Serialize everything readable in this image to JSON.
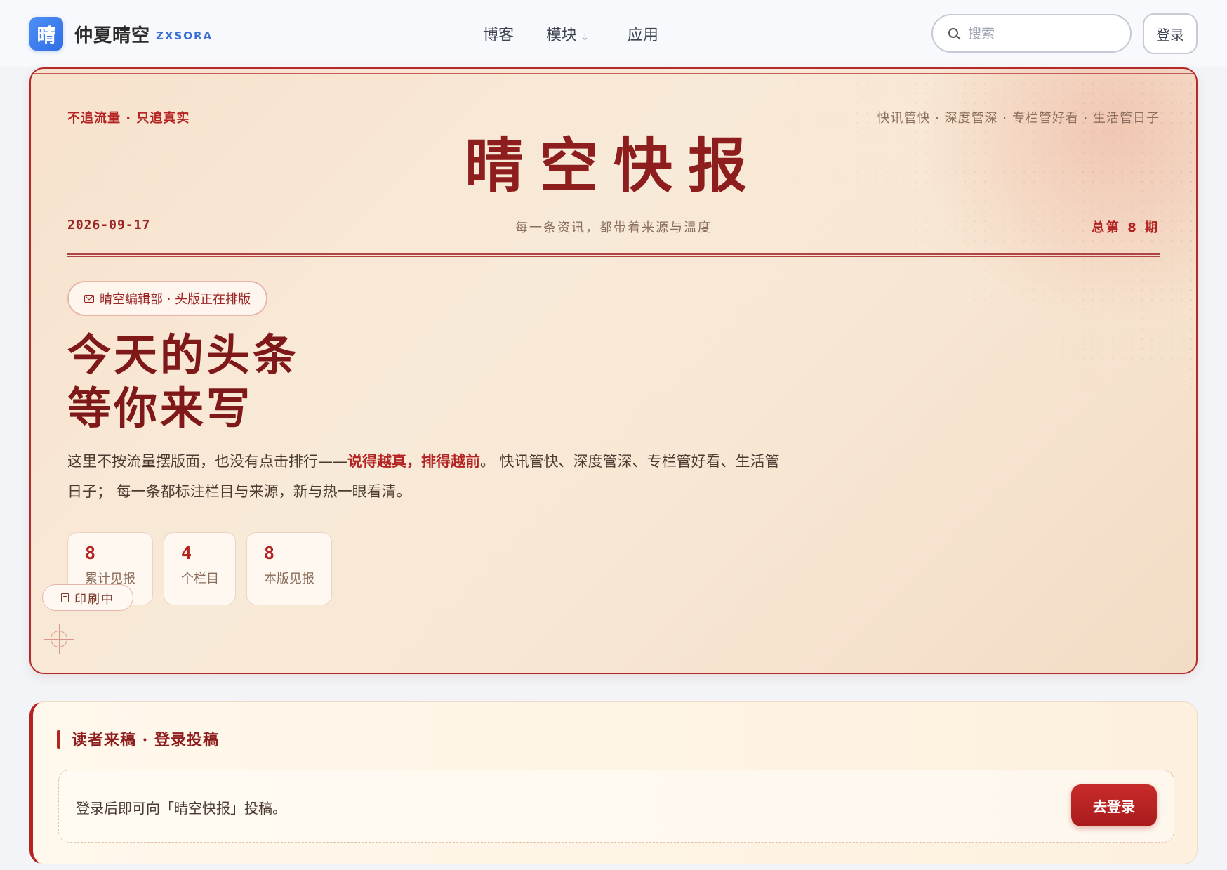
{
  "header": {
    "logo_char": "晴",
    "site_name": "仲夏晴空",
    "site_sub": "ZXSORA",
    "nav": [
      {
        "label": "博客"
      },
      {
        "label": "模块",
        "chevron": "↓"
      },
      {
        "label": "应用"
      }
    ],
    "search_placeholder": "搜索",
    "login_label": "登录"
  },
  "hero": {
    "slogan_left": "不追流量 · 只追真实",
    "slogan_right": "快讯管快 · 深度管深 · 专栏管好看 · 生活管日子",
    "masthead": "晴空快报",
    "date": "2026-09-17",
    "motto": "每一条资讯，都带着来源与温度",
    "issue": "总第 8 期",
    "badge": "晴空编辑部 · 头版正在排版",
    "headline_line1": "今天的头条",
    "headline_line2": "等你来写",
    "lead_part1": "这里不按流量摆版面，也没有点击排行——",
    "lead_strong": "说得越真，排得越前",
    "lead_part2": "。 快讯管快、深度管深、专栏管好看、生活管日子； 每一条都标注栏目与来源，新与热一眼看清。",
    "stats": [
      {
        "num": "8",
        "label": "累计见报"
      },
      {
        "num": "4",
        "label": "个栏目"
      },
      {
        "num": "8",
        "label": "本版见报"
      }
    ],
    "printing": "印刷中"
  },
  "submit": {
    "title": "读者来稿 · 登录投稿",
    "text": "登录后即可向「晴空快报」投稿。",
    "button": "去登录"
  },
  "colors": {
    "accent_red": "#b42222",
    "brand_blue": "#2f6fe4"
  }
}
